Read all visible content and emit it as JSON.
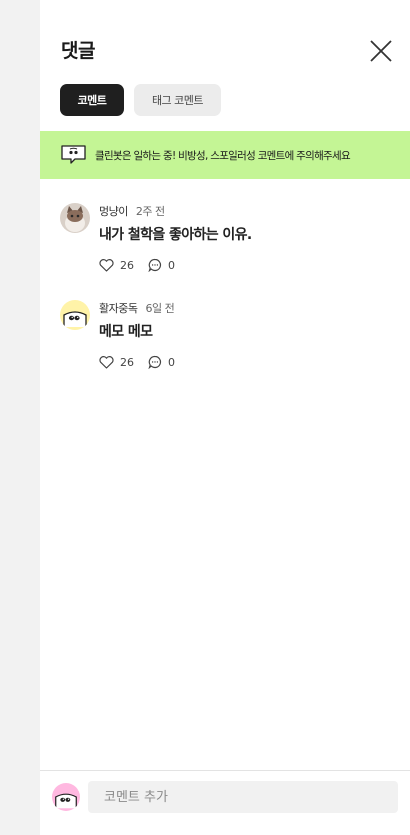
{
  "header": {
    "title": "댓글"
  },
  "tabs": [
    {
      "label": "코멘트",
      "active": true
    },
    {
      "label": "태그 코멘트",
      "active": false
    }
  ],
  "notice": {
    "text": "클린봇은 일하는 중! 비방성, 스포일러성 코멘트에 주의해주세요"
  },
  "comments": [
    {
      "author": "멍냥이",
      "time": "2주 전",
      "body": "내가 철학을 좋아하는 이유.",
      "likes": "26",
      "replies": "0",
      "avatar": "cat-photo"
    },
    {
      "author": "활자중독",
      "time": "6일 전",
      "body": "메모 메모",
      "likes": "26",
      "replies": "0",
      "avatar": "eyes-character"
    }
  ],
  "composer": {
    "placeholder": "코멘트 추가",
    "avatar": "eyes-character-pink"
  },
  "colors": {
    "banner": "#c4f595",
    "active_tab": "#1f1f1f",
    "avatar_yellow": "#fff3a8",
    "avatar_pink": "#ffb8e0"
  }
}
